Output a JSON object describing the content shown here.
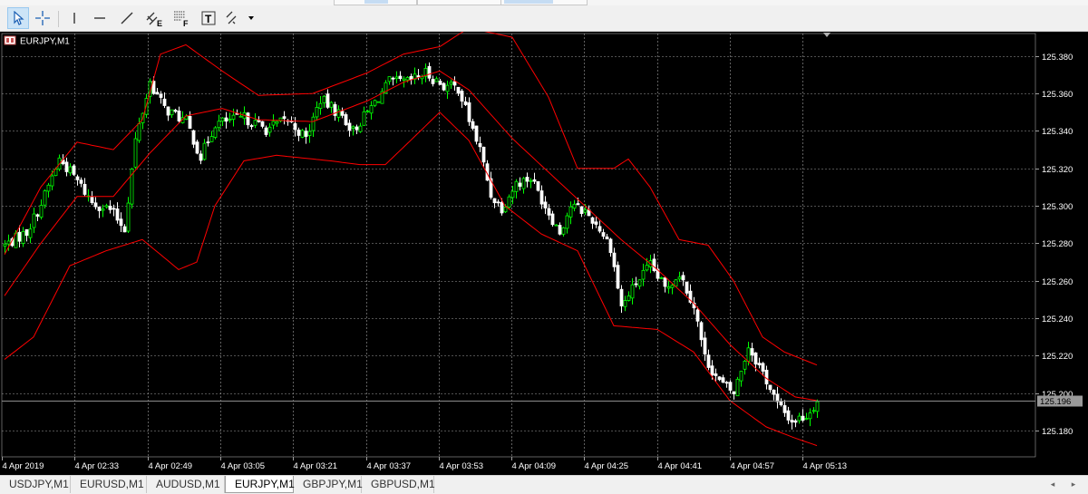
{
  "toolbar": {
    "buttons": [
      {
        "name": "pointer-tool-button",
        "icon": "cursor-arrow-icon",
        "active": true
      },
      {
        "name": "crosshair-tool-button",
        "icon": "crosshair-icon",
        "active": false
      },
      {
        "name": "vertical-line-button",
        "icon": "vertical-line-icon",
        "active": false
      },
      {
        "name": "horizontal-line-button",
        "icon": "horizontal-line-icon",
        "active": false
      },
      {
        "name": "trendline-button",
        "icon": "trendline-icon",
        "active": false
      },
      {
        "name": "equidistant-channel-button",
        "icon": "channel-icon",
        "active": false
      },
      {
        "name": "fibonacci-retracement-button",
        "icon": "fibonacci-icon",
        "active": false
      },
      {
        "name": "text-label-button",
        "icon": "text-icon",
        "active": false
      },
      {
        "name": "arrows-button",
        "icon": "arrows-icon",
        "active": false
      }
    ],
    "labels": {
      "channel": "E",
      "fibonacci": "F",
      "text": "T"
    }
  },
  "chart": {
    "symbol_label": "EURJPY,M1",
    "current_price": "125.196",
    "colors": {
      "background": "#000000",
      "grid": "#a0a0a0",
      "candle_up": "#00ff00",
      "candle_down": "#ffffff",
      "bands": "#ff0000",
      "axis_text": "#ffffff",
      "price_line": "#8c8c8c"
    },
    "price_axis": [
      "125.380",
      "125.360",
      "125.340",
      "125.320",
      "125.300",
      "125.280",
      "125.260",
      "125.240",
      "125.220",
      "125.200",
      "125.180"
    ],
    "time_axis": [
      "4 Apr 2019",
      "4 Apr 02:33",
      "4 Apr 02:49",
      "4 Apr 03:05",
      "4 Apr 03:21",
      "4 Apr 03:37",
      "4 Apr 03:53",
      "4 Apr 04:09",
      "4 Apr 04:25",
      "4 Apr 04:41",
      "4 Apr 04:57",
      "4 Apr 05:13"
    ]
  },
  "chart_data": {
    "type": "candlestick",
    "title": "EURJPY,M1",
    "ylim": [
      125.166,
      125.392
    ],
    "indicator": "Bollinger Bands",
    "close_path": [
      [
        0,
        125.279
      ],
      [
        6,
        125.286
      ],
      [
        10,
        125.301
      ],
      [
        15,
        125.325
      ],
      [
        19,
        125.316
      ],
      [
        24,
        125.302
      ],
      [
        29,
        125.298
      ],
      [
        33,
        125.288
      ],
      [
        36,
        125.335
      ],
      [
        40,
        125.366
      ],
      [
        44,
        125.352
      ],
      [
        50,
        125.345
      ],
      [
        54,
        125.326
      ],
      [
        58,
        125.344
      ],
      [
        66,
        125.347
      ],
      [
        72,
        125.341
      ],
      [
        78,
        125.346
      ],
      [
        83,
        125.336
      ],
      [
        87,
        125.357
      ],
      [
        93,
        125.348
      ],
      [
        96,
        125.34
      ],
      [
        100,
        125.35
      ],
      [
        106,
        125.366
      ],
      [
        111,
        125.366
      ],
      [
        116,
        125.371
      ],
      [
        121,
        125.364
      ],
      [
        125,
        125.363
      ],
      [
        128,
        125.346
      ],
      [
        131,
        125.33
      ],
      [
        134,
        125.306
      ],
      [
        137,
        125.299
      ],
      [
        141,
        125.312
      ],
      [
        145,
        125.315
      ],
      [
        149,
        125.3
      ],
      [
        153,
        125.286
      ],
      [
        156,
        125.3
      ],
      [
        160,
        125.297
      ],
      [
        164,
        125.288
      ],
      [
        167,
        125.278
      ],
      [
        170,
        125.246
      ],
      [
        174,
        125.259
      ],
      [
        178,
        125.268
      ],
      [
        182,
        125.256
      ],
      [
        186,
        125.264
      ],
      [
        190,
        125.247
      ],
      [
        193,
        125.219
      ],
      [
        197,
        125.206
      ],
      [
        201,
        125.2
      ],
      [
        205,
        125.225
      ],
      [
        209,
        125.211
      ],
      [
        213,
        125.194
      ],
      [
        217,
        125.185
      ],
      [
        221,
        125.188
      ],
      [
        224,
        125.196
      ]
    ],
    "bands_upper_path": [
      [
        0,
        125.274
      ],
      [
        10,
        125.31
      ],
      [
        20,
        125.334
      ],
      [
        30,
        125.33
      ],
      [
        38,
        125.346
      ],
      [
        43,
        125.381
      ],
      [
        50,
        125.386
      ],
      [
        60,
        125.372
      ],
      [
        70,
        125.359
      ],
      [
        85,
        125.36
      ],
      [
        100,
        125.371
      ],
      [
        110,
        125.381
      ],
      [
        120,
        125.385
      ],
      [
        128,
        125.395
      ],
      [
        140,
        125.39
      ],
      [
        150,
        125.358
      ],
      [
        158,
        125.32
      ],
      [
        168,
        125.32
      ],
      [
        172,
        125.325
      ],
      [
        178,
        125.31
      ],
      [
        186,
        125.282
      ],
      [
        194,
        125.279
      ],
      [
        201,
        125.26
      ],
      [
        209,
        125.23
      ],
      [
        215,
        125.222
      ],
      [
        224,
        125.215
      ]
    ],
    "bands_middle_path": [
      [
        0,
        125.252
      ],
      [
        10,
        125.28
      ],
      [
        20,
        125.305
      ],
      [
        30,
        125.305
      ],
      [
        40,
        125.328
      ],
      [
        50,
        125.348
      ],
      [
        60,
        125.352
      ],
      [
        70,
        125.346
      ],
      [
        85,
        125.345
      ],
      [
        100,
        125.356
      ],
      [
        110,
        125.366
      ],
      [
        120,
        125.372
      ],
      [
        128,
        125.362
      ],
      [
        140,
        125.336
      ],
      [
        150,
        125.318
      ],
      [
        160,
        125.3
      ],
      [
        170,
        125.282
      ],
      [
        180,
        125.266
      ],
      [
        190,
        125.248
      ],
      [
        200,
        125.226
      ],
      [
        210,
        125.208
      ],
      [
        218,
        125.198
      ],
      [
        224,
        125.196
      ]
    ],
    "bands_lower_path": [
      [
        0,
        125.218
      ],
      [
        8,
        125.23
      ],
      [
        18,
        125.268
      ],
      [
        28,
        125.276
      ],
      [
        38,
        125.282
      ],
      [
        48,
        125.266
      ],
      [
        53,
        125.27
      ],
      [
        58,
        125.3
      ],
      [
        66,
        125.324
      ],
      [
        75,
        125.327
      ],
      [
        90,
        125.324
      ],
      [
        98,
        125.322
      ],
      [
        105,
        125.322
      ],
      [
        112,
        125.335
      ],
      [
        120,
        125.35
      ],
      [
        128,
        125.335
      ],
      [
        138,
        125.3
      ],
      [
        148,
        125.285
      ],
      [
        158,
        125.276
      ],
      [
        168,
        125.236
      ],
      [
        180,
        125.234
      ],
      [
        190,
        125.222
      ],
      [
        200,
        125.196
      ],
      [
        210,
        125.182
      ],
      [
        218,
        125.176
      ],
      [
        224,
        125.172
      ]
    ]
  },
  "tabs": [
    {
      "label": "USDJPY,M1",
      "active": false
    },
    {
      "label": "EURUSD,M1",
      "active": false
    },
    {
      "label": "AUDUSD,M1",
      "active": false
    },
    {
      "label": "EURJPY,M1",
      "active": true
    },
    {
      "label": "GBPJPY,M1",
      "active": false
    },
    {
      "label": "GBPUSD,M1",
      "active": false
    }
  ],
  "scroll": {
    "left": "◂",
    "right": "▸"
  }
}
